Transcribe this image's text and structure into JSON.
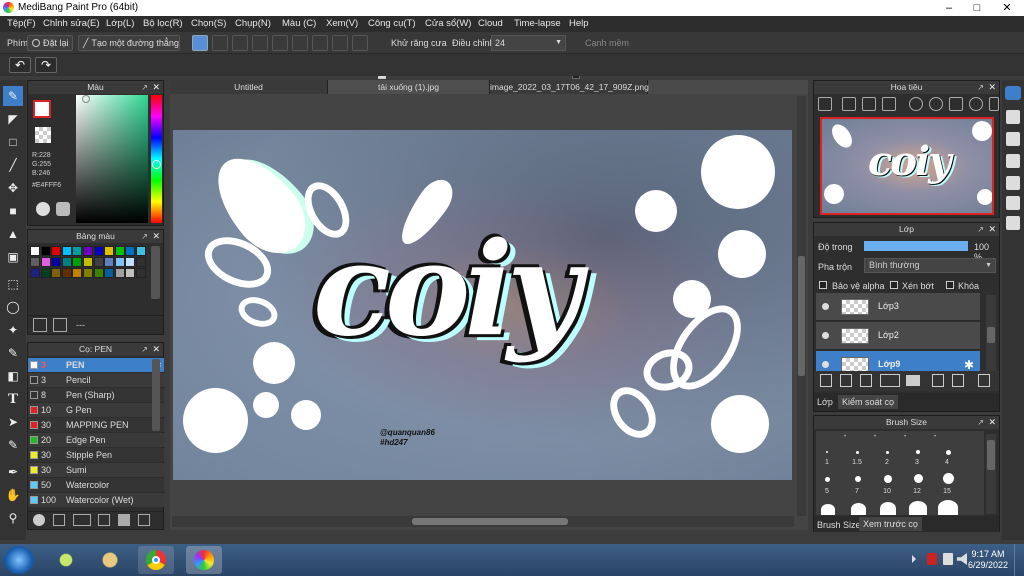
{
  "app": {
    "title": "MediBang Paint Pro (64bit)"
  },
  "menu": [
    "Tệp(F)",
    "Chỉnh sửa(E)",
    "Lớp(L)",
    "Bộ lọc(R)",
    "Chọn(S)",
    "Chụp(N)",
    "Màu (C)",
    "Xem(V)",
    "Công cụ(T)",
    "Cửa sổ(W)",
    "Cloud",
    "Time-lapse",
    "Help"
  ],
  "toolopts": {
    "label": "Phím",
    "reset": "Đặt lại",
    "create_line": "Tạo một đường thẳng",
    "antialias": "Khử răng cưa",
    "adjust_label": "Điều chỉnh",
    "adjust_value": "24",
    "edge": "Cạnh mềm"
  },
  "color_panel": {
    "title": "Màu",
    "r": "R:228",
    "g": "G:255",
    "b": "B:246",
    "hex": "#E4FFF6"
  },
  "palette_panel": {
    "title": "Bảng màu",
    "footer": "---"
  },
  "brush_panel": {
    "title": "Cọ: PEN",
    "items": [
      {
        "size": "3",
        "name": "PEN",
        "color": "#ffffff"
      },
      {
        "size": "3",
        "name": "Pencil",
        "color": "#333333"
      },
      {
        "size": "8",
        "name": "Pen (Sharp)",
        "color": "#333333"
      },
      {
        "size": "10",
        "name": "G Pen",
        "color": "#e22222"
      },
      {
        "size": "30",
        "name": "MAPPING PEN",
        "color": "#e22222"
      },
      {
        "size": "20",
        "name": "Edge Pen",
        "color": "#22bb22"
      },
      {
        "size": "30",
        "name": "Stipple Pen",
        "color": "#eeee22"
      },
      {
        "size": "30",
        "name": "Sumi",
        "color": "#eeee22"
      },
      {
        "size": "50",
        "name": "Watercolor",
        "color": "#55ccff"
      },
      {
        "size": "100",
        "name": "Watercolor (Wet)",
        "color": "#55ccff"
      }
    ]
  },
  "tabs": [
    "Untitled",
    "tải xuống (1).jpg",
    "image_2022_03_17T06_42_17_909Z.png"
  ],
  "artwork": {
    "main_word": "coiy",
    "credit1": "@quanquan86",
    "credit2": "#hd247"
  },
  "nav_panel": {
    "title": "Hoa tiêu"
  },
  "layer_panel": {
    "title": "Lớp",
    "opacity_label": "Độ trong",
    "opacity_value": "100 %",
    "opacity_fraction": 1.0,
    "blend_label": "Pha trộn",
    "blend_value": "Bình thường",
    "protect_alpha": "Bảo vệ alpha",
    "clipping": "Xén bớt",
    "lock": "Khóa",
    "layers": [
      "Lớp3",
      "Lớp2",
      "Lớp9"
    ],
    "tab1": "Lớp",
    "tab2": "Kiểm soát cọ"
  },
  "brushsize_panel": {
    "title": "Brush Size",
    "row1": [
      "1",
      "1.5",
      "2",
      "3",
      "4"
    ],
    "row2": [
      "5",
      "7",
      "10",
      "12",
      "15"
    ],
    "tab1": "Brush Size",
    "tab2": "Xem trước cọ"
  },
  "taskbar": {
    "time": "9:17 AM",
    "date": "6/29/2022"
  },
  "colors": {
    "accent": "#3d7fc8",
    "primary_color": "#E4FFF6",
    "bg": "#2e2e2e"
  }
}
